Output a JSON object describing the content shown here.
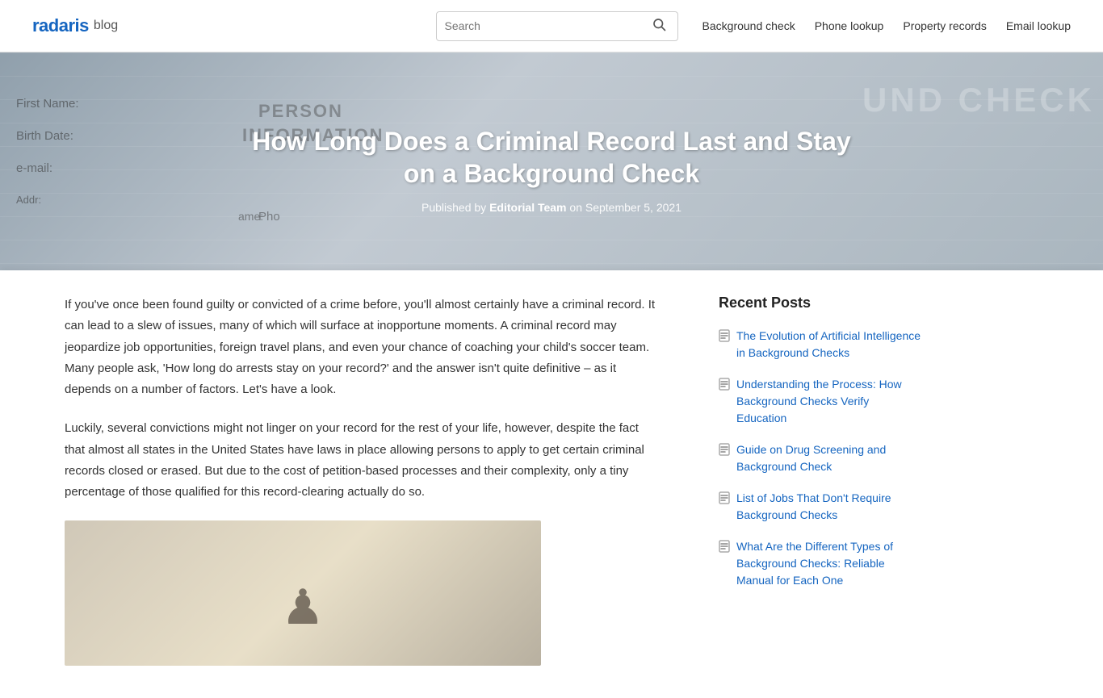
{
  "header": {
    "logo_brand": "radaris",
    "logo_suffix": "blog",
    "search_placeholder": "Search",
    "nav_links": [
      {
        "label": "Background check",
        "id": "nav-background-check"
      },
      {
        "label": "Phone lookup",
        "id": "nav-phone-lookup"
      },
      {
        "label": "Property records",
        "id": "nav-property-records"
      },
      {
        "label": "Email lookup",
        "id": "nav-email-lookup"
      }
    ]
  },
  "hero": {
    "title": "How Long Does a Criminal Record Last and Stay on a Background Check",
    "meta_prefix": "Published by",
    "meta_author": "Editorial Team",
    "meta_date_prefix": "on",
    "meta_date": "September 5, 2021"
  },
  "article": {
    "paragraphs": [
      "If you've once been found guilty or convicted of a crime before, you'll almost certainly have a criminal record. It can lead to a slew of issues, many of which will surface at inopportune moments. A criminal record may jeopardize job opportunities, foreign travel plans, and even your chance of coaching your child's soccer team. Many people ask, 'How long do arrests stay on your record?' and the answer isn't quite definitive – as it depends on a number of factors. Let's have a look.",
      "Luckily, several convictions might not linger on your record for the rest of your life, however, despite the fact that almost all states in the United States have laws in place allowing persons to apply to get certain criminal records closed or erased. But due to the cost of petition-based processes and their complexity, only a tiny percentage of those qualified for this record-clearing actually do so."
    ]
  },
  "sidebar": {
    "title": "Recent Posts",
    "posts": [
      {
        "text": "The Evolution of Artificial Intelligence in Background Checks"
      },
      {
        "text": "Understanding the Process: How Background Checks Verify Education"
      },
      {
        "text": "Guide on Drug Screening and Background Check"
      },
      {
        "text": "List of Jobs That Don't Require Background Checks"
      },
      {
        "text": "What Are the Different Types of Background Checks: Reliable Manual for Each One"
      }
    ]
  }
}
